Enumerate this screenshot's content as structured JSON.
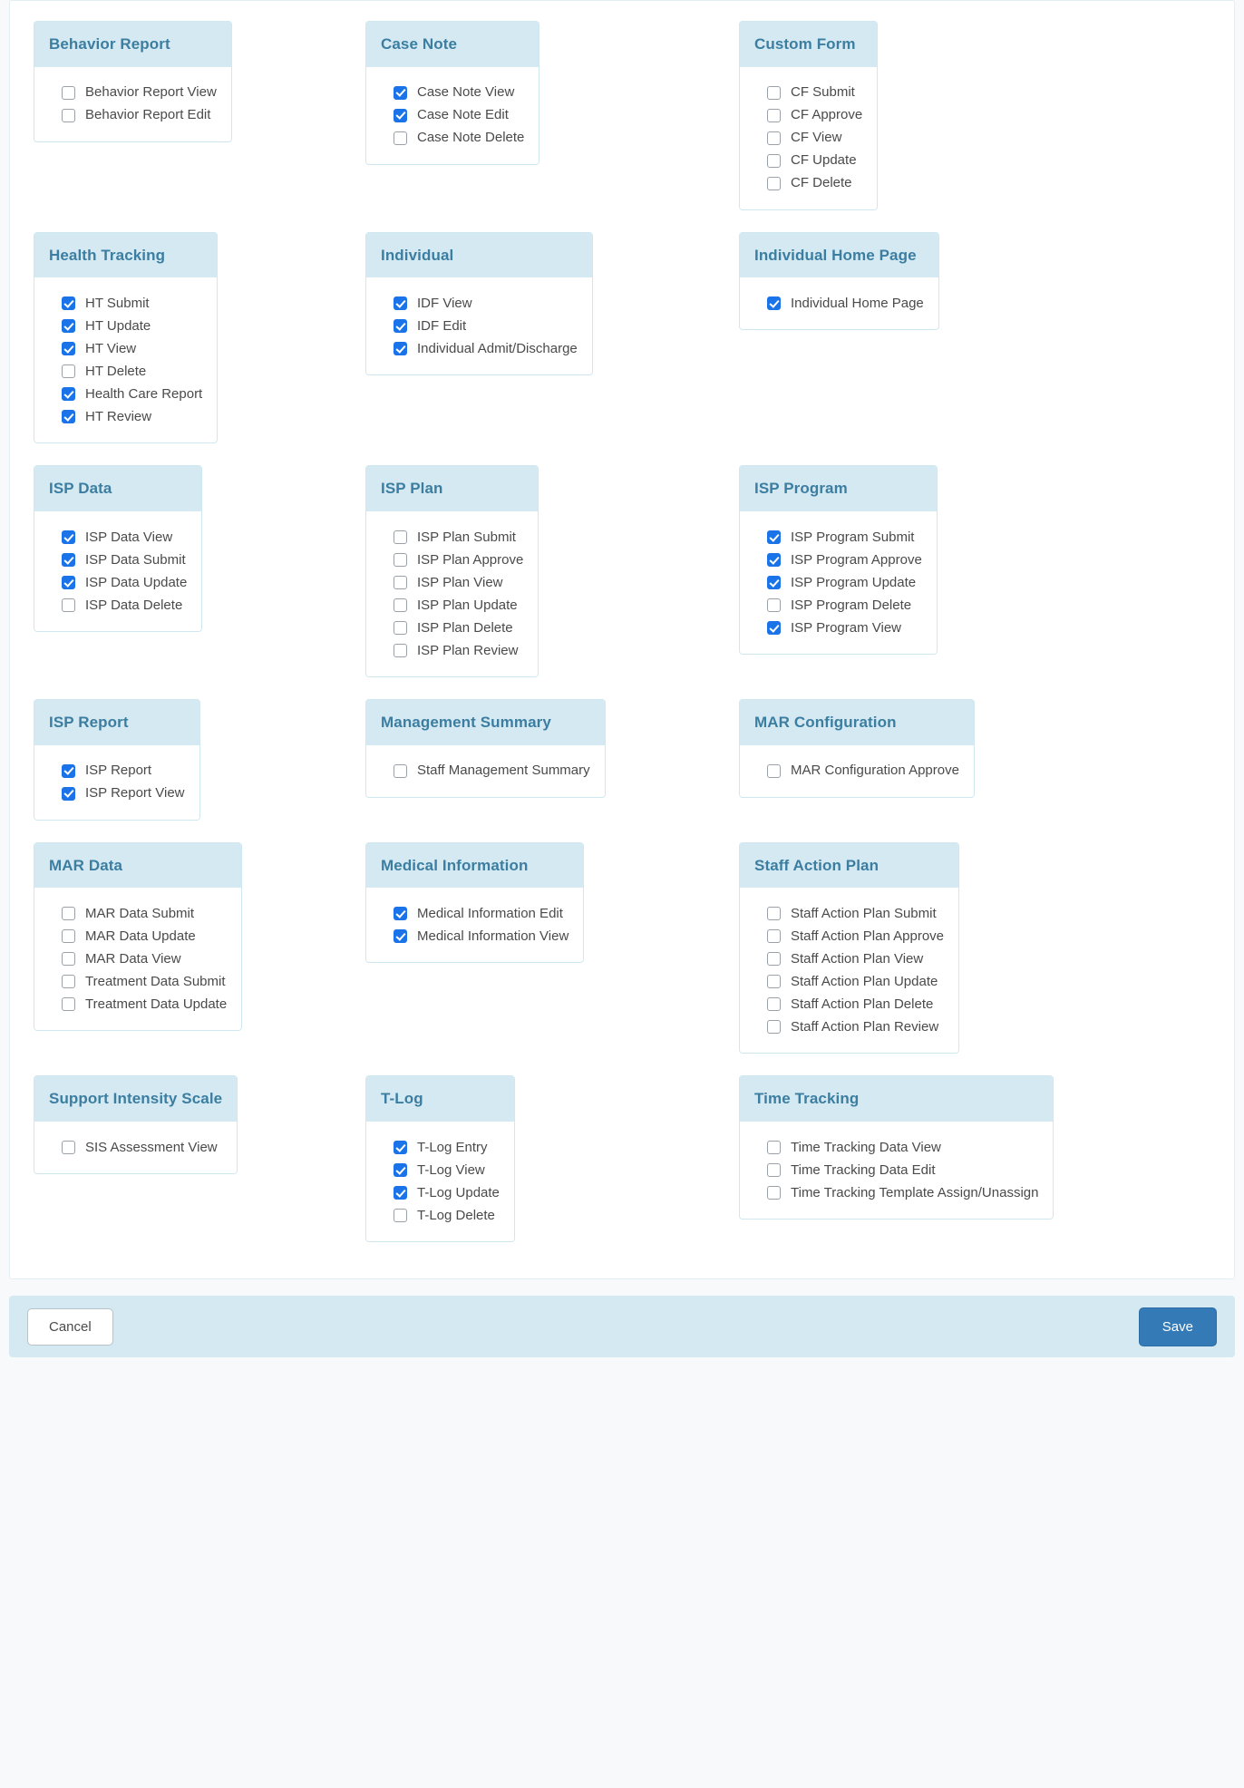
{
  "footer": {
    "cancel_label": "Cancel",
    "save_label": "Save"
  },
  "colors": {
    "header_bg": "#d5e9f2",
    "header_text": "#3b7ea1",
    "checkbox_checked": "#1a73e8",
    "save_button": "#337ab7",
    "card_border": "#cfe7ef"
  },
  "groups": [
    {
      "title": "Behavior Report",
      "column": 1,
      "row": 1,
      "items": [
        {
          "label": "Behavior Report View",
          "checked": false
        },
        {
          "label": "Behavior Report Edit",
          "checked": false
        }
      ]
    },
    {
      "title": "Case Note",
      "column": 2,
      "row": 1,
      "items": [
        {
          "label": "Case Note View",
          "checked": true
        },
        {
          "label": "Case Note Edit",
          "checked": true
        },
        {
          "label": "Case Note Delete",
          "checked": false
        }
      ]
    },
    {
      "title": "Custom Form",
      "column": 3,
      "row": 1,
      "items": [
        {
          "label": "CF Submit",
          "checked": false
        },
        {
          "label": "CF Approve",
          "checked": false
        },
        {
          "label": "CF View",
          "checked": false
        },
        {
          "label": "CF Update",
          "checked": false
        },
        {
          "label": "CF Delete",
          "checked": false
        }
      ]
    },
    {
      "title": "Health Tracking",
      "column": 1,
      "row": 2,
      "items": [
        {
          "label": "HT Submit",
          "checked": true
        },
        {
          "label": "HT Update",
          "checked": true
        },
        {
          "label": "HT View",
          "checked": true
        },
        {
          "label": "HT Delete",
          "checked": false
        },
        {
          "label": "Health Care Report",
          "checked": true
        },
        {
          "label": "HT Review",
          "checked": true
        }
      ]
    },
    {
      "title": "Individual",
      "column": 2,
      "row": 2,
      "items": [
        {
          "label": "IDF View",
          "checked": true
        },
        {
          "label": "IDF Edit",
          "checked": true
        },
        {
          "label": "Individual Admit/Discharge",
          "checked": true
        }
      ]
    },
    {
      "title": "Individual Home Page",
      "column": 3,
      "row": 2,
      "items": [
        {
          "label": "Individual Home Page",
          "checked": true
        }
      ]
    },
    {
      "title": "ISP Data",
      "column": 1,
      "row": 3,
      "items": [
        {
          "label": "ISP Data View",
          "checked": true
        },
        {
          "label": "ISP Data Submit",
          "checked": true
        },
        {
          "label": "ISP Data Update",
          "checked": true
        },
        {
          "label": "ISP Data Delete",
          "checked": false
        }
      ]
    },
    {
      "title": "ISP Plan",
      "column": 2,
      "row": 3,
      "items": [
        {
          "label": "ISP Plan Submit",
          "checked": false
        },
        {
          "label": "ISP Plan Approve",
          "checked": false
        },
        {
          "label": "ISP Plan View",
          "checked": false
        },
        {
          "label": "ISP Plan Update",
          "checked": false
        },
        {
          "label": "ISP Plan Delete",
          "checked": false
        },
        {
          "label": "ISP Plan Review",
          "checked": false
        }
      ]
    },
    {
      "title": "ISP Program",
      "column": 3,
      "row": 3,
      "items": [
        {
          "label": "ISP Program Submit",
          "checked": true
        },
        {
          "label": "ISP Program Approve",
          "checked": true
        },
        {
          "label": "ISP Program Update",
          "checked": true
        },
        {
          "label": "ISP Program Delete",
          "checked": false
        },
        {
          "label": "ISP Program View",
          "checked": true
        }
      ]
    },
    {
      "title": "ISP Report",
      "column": 1,
      "row": 4,
      "items": [
        {
          "label": "ISP Report",
          "checked": true
        },
        {
          "label": "ISP Report View",
          "checked": true
        }
      ]
    },
    {
      "title": "Management Summary",
      "column": 2,
      "row": 4,
      "items": [
        {
          "label": "Staff Management Summary",
          "checked": false
        }
      ]
    },
    {
      "title": "MAR Configuration",
      "column": 3,
      "row": 4,
      "items": [
        {
          "label": "MAR Configuration Approve",
          "checked": false
        }
      ]
    },
    {
      "title": "MAR Data",
      "column": 1,
      "row": 5,
      "items": [
        {
          "label": "MAR Data Submit",
          "checked": false
        },
        {
          "label": "MAR Data Update",
          "checked": false
        },
        {
          "label": "MAR Data View",
          "checked": false
        },
        {
          "label": "Treatment Data Submit",
          "checked": false
        },
        {
          "label": "Treatment Data Update",
          "checked": false
        }
      ]
    },
    {
      "title": "Medical Information",
      "column": 2,
      "row": 5,
      "items": [
        {
          "label": "Medical Information Edit",
          "checked": true
        },
        {
          "label": "Medical Information View",
          "checked": true
        }
      ]
    },
    {
      "title": "Staff Action Plan",
      "column": 3,
      "row": 5,
      "items": [
        {
          "label": "Staff Action Plan Submit",
          "checked": false
        },
        {
          "label": "Staff Action Plan Approve",
          "checked": false
        },
        {
          "label": "Staff Action Plan View",
          "checked": false
        },
        {
          "label": "Staff Action Plan Update",
          "checked": false
        },
        {
          "label": "Staff Action Plan Delete",
          "checked": false
        },
        {
          "label": "Staff Action Plan Review",
          "checked": false
        }
      ]
    },
    {
      "title": "Support Intensity Scale",
      "column": 1,
      "row": 6,
      "items": [
        {
          "label": "SIS Assessment View",
          "checked": false
        }
      ]
    },
    {
      "title": "T-Log",
      "column": 2,
      "row": 6,
      "items": [
        {
          "label": "T-Log Entry",
          "checked": true
        },
        {
          "label": "T-Log View",
          "checked": true
        },
        {
          "label": "T-Log Update",
          "checked": true
        },
        {
          "label": "T-Log Delete",
          "checked": false
        }
      ]
    },
    {
      "title": "Time Tracking",
      "column": 3,
      "row": 6,
      "items": [
        {
          "label": "Time Tracking Data View",
          "checked": false
        },
        {
          "label": "Time Tracking Data Edit",
          "checked": false
        },
        {
          "label": "Time Tracking Template Assign/Unassign",
          "checked": false
        }
      ]
    }
  ]
}
